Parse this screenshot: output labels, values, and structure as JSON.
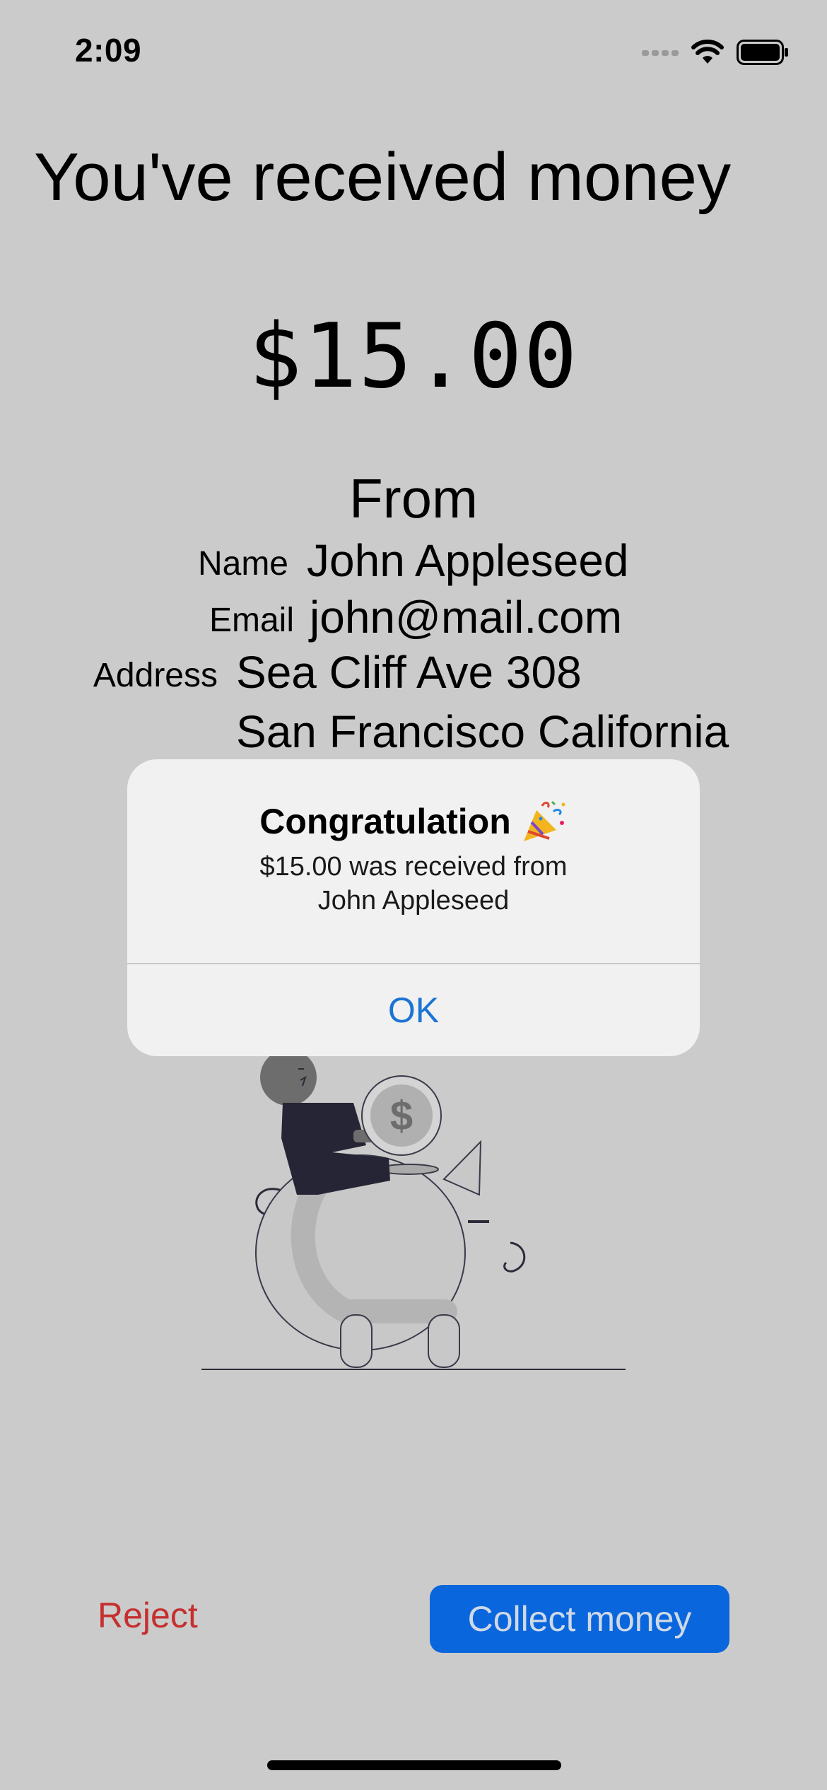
{
  "status_bar": {
    "time": "2:09",
    "icons": [
      "signal-icon",
      "wifi-icon",
      "battery-icon"
    ]
  },
  "title": "You've received money",
  "amount": "$15.00",
  "from": {
    "heading": "From",
    "name_label": "Name",
    "name_value": "John Appleseed",
    "email_label": "Email",
    "email_value": "john@mail.com",
    "address_label": "Address",
    "address_line1": "Sea Cliff Ave 308",
    "address_line2": "San Francisco  California"
  },
  "alert": {
    "title": "Congratulation",
    "title_icon": "party-popper-icon",
    "message_line1": "$15.00 was received from",
    "message_line2": "John Appleseed",
    "ok_label": "OK"
  },
  "actions": {
    "reject_label": "Reject",
    "collect_label": "Collect money"
  },
  "illustration": "piggy-bank-illustration",
  "colors": {
    "background": "#cbcbcb",
    "reject": "#c62f2f",
    "collect_button": "#0966dc",
    "alert_link": "#1b74d4"
  }
}
